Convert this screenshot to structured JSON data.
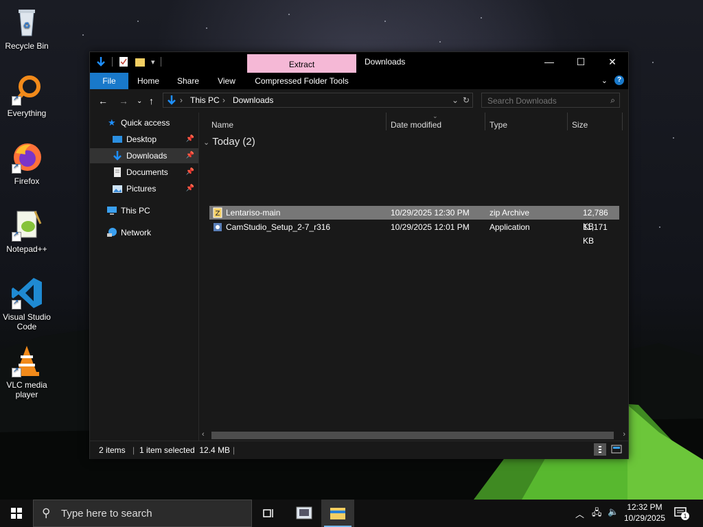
{
  "desktop": {
    "icons": [
      {
        "label": "Recycle Bin",
        "icon": "recycle-bin-icon"
      },
      {
        "label": "Everything",
        "icon": "everything-icon"
      },
      {
        "label": "Firefox",
        "icon": "firefox-icon"
      },
      {
        "label": "Notepad++",
        "icon": "notepad-plus-plus-icon"
      },
      {
        "label": "Visual Studio Code",
        "icon": "vscode-icon"
      },
      {
        "label": "VLC media player",
        "icon": "vlc-icon"
      }
    ]
  },
  "window": {
    "title": "Downloads",
    "context_tab": "Extract",
    "caption": {
      "minimize": "—",
      "maximize": "☐",
      "close": "✕"
    },
    "ribbon_tabs": [
      "File",
      "Home",
      "Share",
      "View",
      "Compressed Folder Tools"
    ],
    "breadcrumb": [
      "This PC",
      "Downloads"
    ],
    "search_placeholder": "Search Downloads",
    "nav_pane": {
      "quick_access": "Quick access",
      "items": [
        "Desktop",
        "Downloads",
        "Documents",
        "Pictures"
      ],
      "this_pc": "This PC",
      "network": "Network"
    },
    "columns": [
      "Name",
      "Date modified",
      "Type",
      "Size"
    ],
    "group_label": "Today (2)",
    "files": [
      {
        "name": "Lentariso-main",
        "date": "10/29/2025 12:30 PM",
        "type": "zip Archive",
        "size": "12,786 KB",
        "selected": true
      },
      {
        "name": "CamStudio_Setup_2-7_r316",
        "date": "10/29/2025 12:01 PM",
        "type": "Application",
        "size": "11,171 KB",
        "selected": false
      }
    ],
    "status": {
      "items": "2 items",
      "selected": "1 item selected  12.4 MB"
    }
  },
  "taskbar": {
    "search_placeholder": "Type here to search",
    "time": "12:32 PM",
    "date": "10/29/2025",
    "notification_count": "1"
  },
  "colors": {
    "accent": "#1979ca",
    "context_tab": "#f5b8d6",
    "selection": "#777777"
  }
}
